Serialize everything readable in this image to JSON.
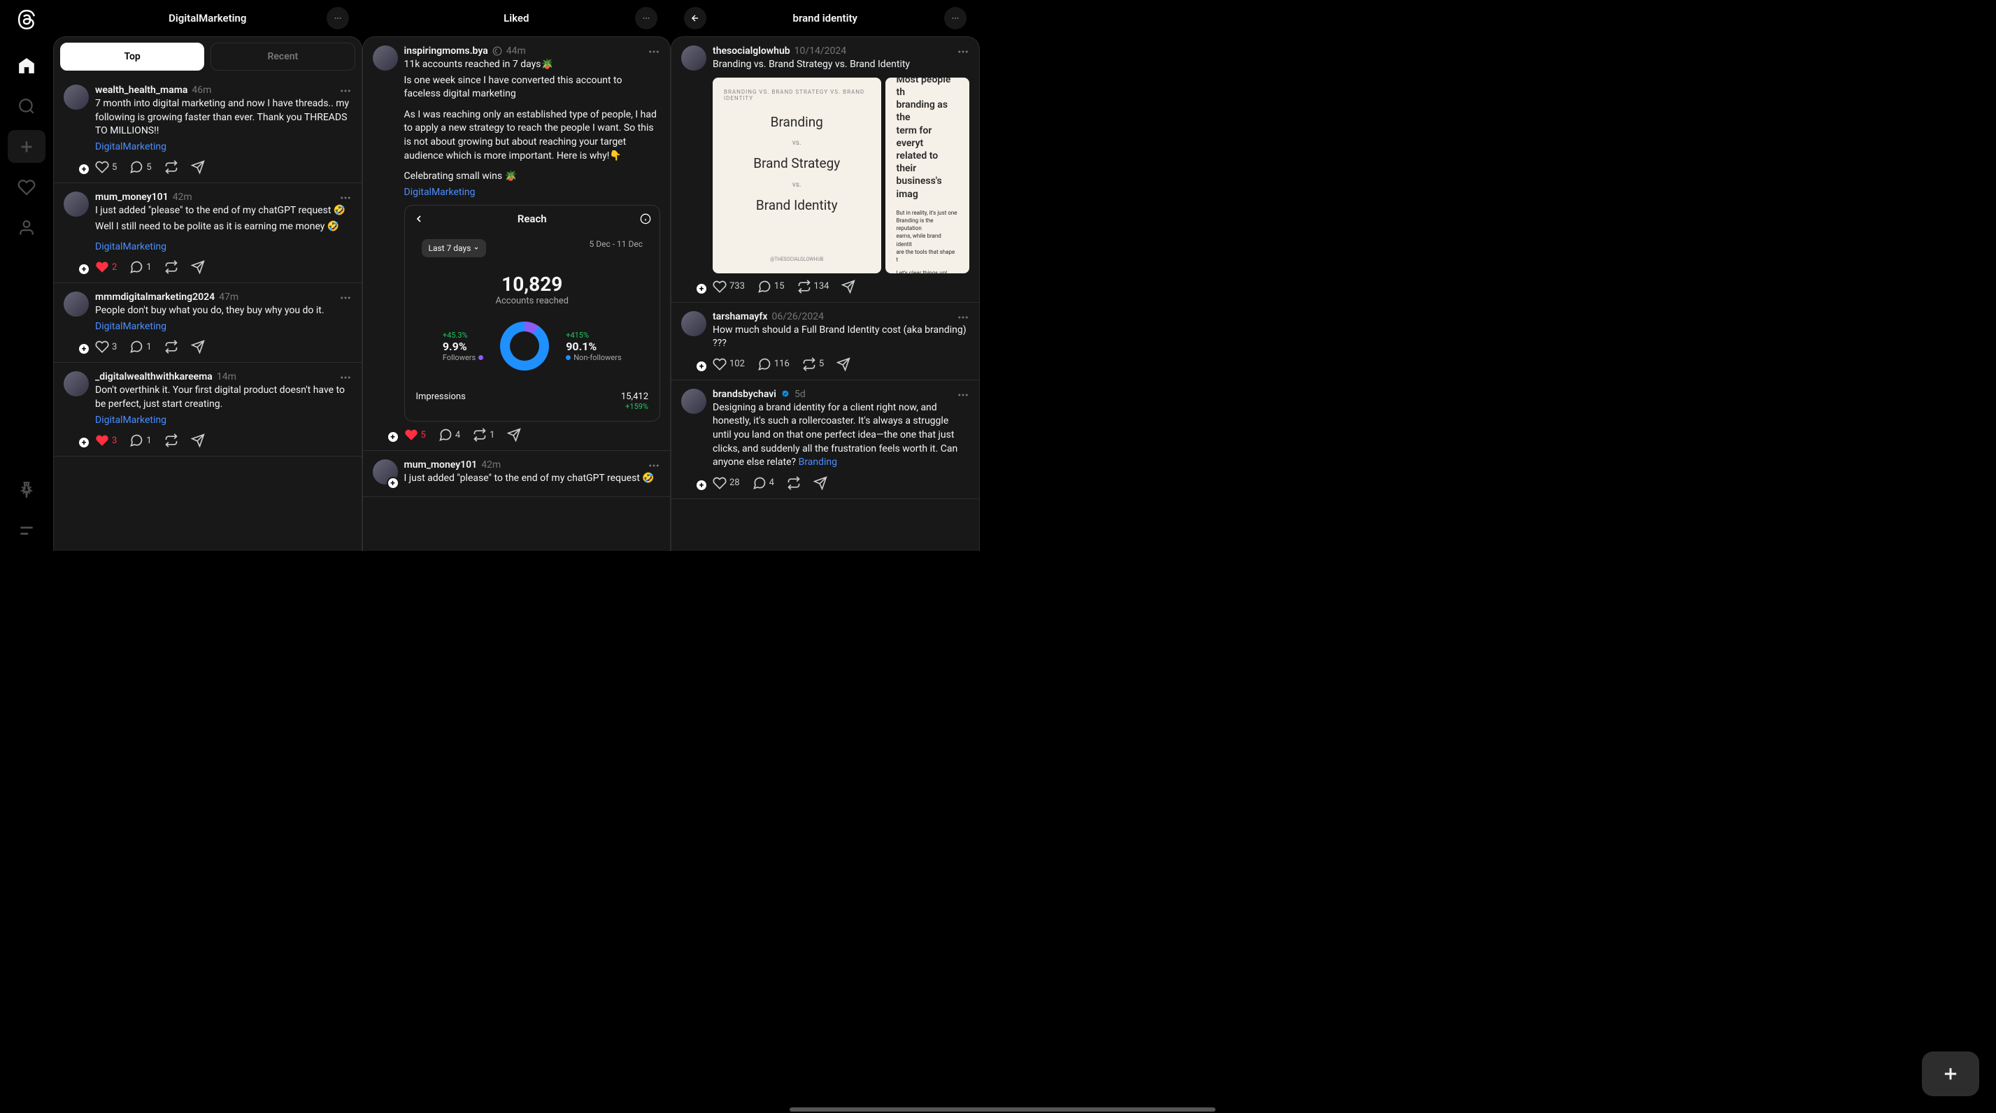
{
  "sidebar": {
    "nav": [
      "home",
      "search",
      "create",
      "activity",
      "profile"
    ],
    "bottom": [
      "pin",
      "menu"
    ]
  },
  "columns": [
    {
      "title": "DigitalMarketing",
      "tabs": {
        "top": "Top",
        "recent": "Recent",
        "active": "top"
      }
    },
    {
      "title": "Liked"
    },
    {
      "title": "brand identity",
      "back": true
    }
  ],
  "col1_posts": [
    {
      "user": "wealth_health_mama",
      "time": "46m",
      "text": "7 month into digital marketing and now I have threads.. my following is growing faster than ever. Thank you THREADS TO MILLIONS!!",
      "tag": "DigitalMarketing",
      "likes": "5",
      "replies": "5",
      "liked": false
    },
    {
      "user": "mum_money101",
      "time": "42m",
      "text": "I just added \"please\" to the end of my chatGPT request 🤣",
      "text2": "Well I still need to be polite as it is earning me money 🤣",
      "tag": "DigitalMarketing",
      "likes": "2",
      "replies": "1",
      "liked": true
    },
    {
      "user": "mmmdigitalmarketing2024",
      "time": "47m",
      "text": "People don't buy what you do, they buy why you do it.",
      "tag": "DigitalMarketing",
      "likes": "3",
      "replies": "1",
      "liked": false
    },
    {
      "user": "_digitalwealthwithkareema",
      "time": "14m",
      "text": "Don't overthink it. Your first digital product doesn't have to be perfect, just start creating.",
      "tag": "DigitalMarketing",
      "likes": "3",
      "replies": "1",
      "liked": true
    }
  ],
  "col2_posts": [
    {
      "user": "inspiringmoms.bya",
      "time": "44m",
      "p1": "11k accounts reached in 7 days🪴",
      "p2": "Is one week since I have converted this account to faceless digital marketing",
      "p3": "As I was reaching only an established type of people, I had to apply a new strategy to reach the people I want. So this is not about growing but about reaching your target audience which is more important. Here is why!👇",
      "p4": "Celebrating small wins 🪴",
      "tag": "DigitalMarketing",
      "analytics": {
        "title": "Reach",
        "period_label": "Last 7 days",
        "date_range": "5 Dec - 11 Dec",
        "big_number": "10,829",
        "big_label": "Accounts reached",
        "followers": {
          "pct": "+45.3%",
          "val": "9.9%",
          "lbl": "Followers"
        },
        "nonfollowers": {
          "pct": "+415%",
          "val": "90.1%",
          "lbl": "Non-followers"
        },
        "impressions_label": "Impressions",
        "impressions_val": "15,412",
        "impressions_delta": "+159%"
      },
      "likes": "5",
      "replies": "4",
      "reposts": "1",
      "liked": true
    },
    {
      "user": "mum_money101",
      "time": "42m",
      "text": "I just added \"please\" to the end of my chatGPT request 🤣"
    }
  ],
  "col3_posts": [
    {
      "user": "thesocialglowhub",
      "time": "10/14/2024",
      "text": "Branding vs. Brand Strategy vs. Brand Identity",
      "img1": {
        "header": "BRANDING VS. BRAND STRATEGY VS. BRAND IDENTITY",
        "l1": "Branding",
        "vs": "vs.",
        "l2": "Brand Strategy",
        "l3": "Brand Identity",
        "footer": "@THESOCIALGLOWHUB"
      },
      "img2": {
        "p1": "Most people th",
        "p2": "branding as the",
        "p3": "term for everyt",
        "p4": "related to their",
        "p5": "business's imag",
        "p6": "But in reality, it's just one",
        "p7": "Branding is the reputation",
        "p8": "earns, while brand identit",
        "p9": "are the tools that shape t",
        "p10": "Let's clear things up!"
      },
      "likes": "733",
      "replies": "15",
      "reposts": "134"
    },
    {
      "user": "tarshamayfx",
      "time": "06/26/2024",
      "text": "How much should a Full Brand Identity cost (aka branding) ???",
      "likes": "102",
      "replies": "116",
      "reposts": "5"
    },
    {
      "user": "brandsbychavi",
      "time": "5d",
      "verified": true,
      "text": "Designing a brand identity for a client right now, and honestly, it's such a rollercoaster. It's always a struggle until you land on that one perfect idea—the one that just clicks, and suddenly all the frustration feels worth it. Can anyone else relate? ",
      "tag": "Branding",
      "likes": "28",
      "replies": "4"
    }
  ]
}
